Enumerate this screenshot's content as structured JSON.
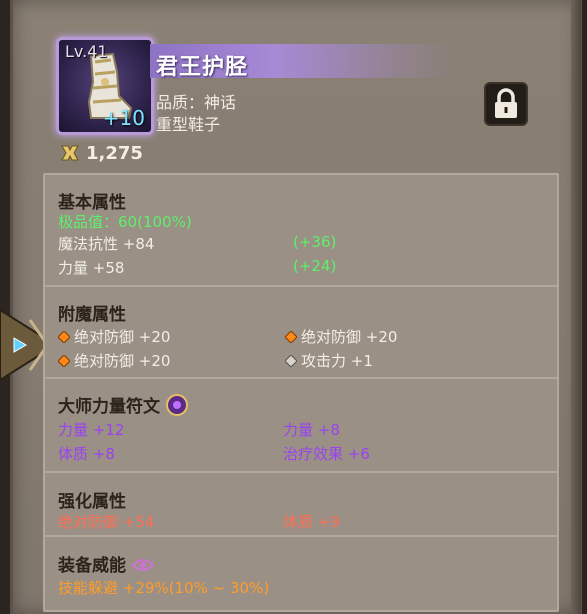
{
  "item": {
    "level": "Lv.41",
    "enhance": "+10",
    "name": "君王护胫",
    "quality": "品质：神话",
    "type": "重型鞋子",
    "gear_score": "1,275",
    "lock_icon": "lock-icon"
  },
  "base": {
    "title": "基本属性",
    "extreme": "极品值：60(100%)",
    "rows": [
      {
        "label": "魔法抗性 +84",
        "bonus": "(+36)"
      },
      {
        "label": "力量 +58",
        "bonus": "(+24)"
      }
    ]
  },
  "enchant": {
    "title": "附魔属性",
    "items": [
      "绝对防御 +20",
      "绝对防御 +20",
      "绝对防御 +20",
      "攻击力 +1"
    ]
  },
  "rune": {
    "title": "大师力量符文",
    "items": [
      "力量 +12",
      "力量 +8",
      "体质 +8",
      "治疗效果 +6"
    ]
  },
  "reinforce": {
    "title": "强化属性",
    "items": [
      "绝对防御 +54",
      "体质 +9"
    ]
  },
  "prestige": {
    "title": "装备威能",
    "value": "技能躲避 +29%(10% ~ 30%)"
  },
  "colors": {
    "green": "#5ff06a",
    "orange": "#ff9c2a",
    "purple": "#9a42f0",
    "red": "#ff6e55"
  }
}
